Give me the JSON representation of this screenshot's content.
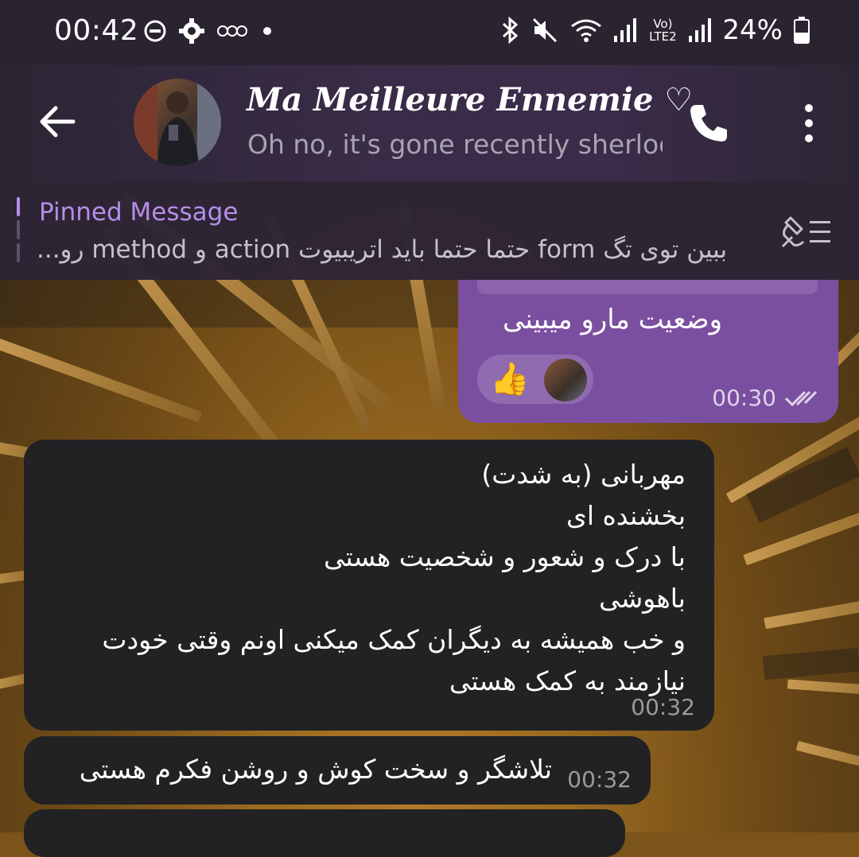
{
  "status_bar": {
    "time": "00:42",
    "network_label": "Vo) LTE2",
    "battery": "24%"
  },
  "header": {
    "title": "Ma Meilleure Ennemie ♡",
    "subtitle": "Oh no, it's gone recently sherlock"
  },
  "pinned": {
    "label": "Pinned Message",
    "text": "ببین توی تگ form حتما حتما باید اتریبیوت action و method رو..."
  },
  "messages": [
    {
      "direction": "outgoing",
      "text": "وضعیت مارو میبینی",
      "reaction": "👍",
      "time": "00:30",
      "status": "read"
    },
    {
      "direction": "incoming",
      "lines": [
        "مهربانی (به شدت)",
        "بخشنده ای",
        "با درک و شعور و شخصیت هستی",
        "باهوشی",
        "و خب همیشه به دیگران کمک میکنی اونم وقتی خودت",
        "نیازمند به کمک هستی"
      ],
      "time": "00:32"
    },
    {
      "direction": "incoming",
      "text": "تلاشگر و سخت کوش و روشن فکرم هستی",
      "time": "00:32"
    }
  ],
  "colors": {
    "accent": "#b58ee8",
    "outgoing_bubble": "#7b4fa0",
    "incoming_bubble": "#222224",
    "header_bg": "#3a2c48"
  },
  "icons": {
    "status_left": [
      "dnd-icon",
      "settings-icon",
      "voicemail-icon",
      "dot-icon"
    ],
    "status_right": [
      "bluetooth-icon",
      "mute-icon",
      "wifi-icon",
      "signal-icon",
      "signal-icon",
      "battery-icon"
    ]
  }
}
